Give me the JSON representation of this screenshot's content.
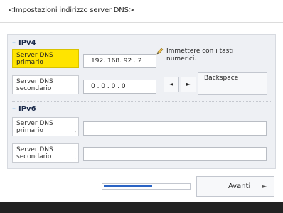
{
  "header": {
    "title": "<Impostazioni indirizzo server DNS>"
  },
  "ipv4": {
    "section_label": "IPv4",
    "primary": {
      "label_line1": "Server DNS",
      "label_line2": "primario",
      "value": "192. 168. 92 . 2"
    },
    "secondary": {
      "label_line1": "Server DNS",
      "label_line2": "secondario",
      "value": "0  . 0  . 0  . 0"
    }
  },
  "hint": {
    "text": "Immettere con i tasti numerici."
  },
  "keys": {
    "left": "◄",
    "right": "►",
    "backspace": "Backspace"
  },
  "ipv6": {
    "section_label": "IPv6",
    "primary": {
      "label_line1": "Server DNS",
      "label_line2": "primario",
      "mark": ",",
      "value": ""
    },
    "secondary": {
      "label_line1": "Server DNS",
      "label_line2": "secondario",
      "mark": ",",
      "value": ""
    }
  },
  "footer": {
    "progress_fraction": 0.57,
    "next_label": "Avanti",
    "next_arrow": "►"
  },
  "colors": {
    "selected": "#ffe400",
    "accent": "#2f8fe0",
    "progress": "#2a63c4"
  }
}
